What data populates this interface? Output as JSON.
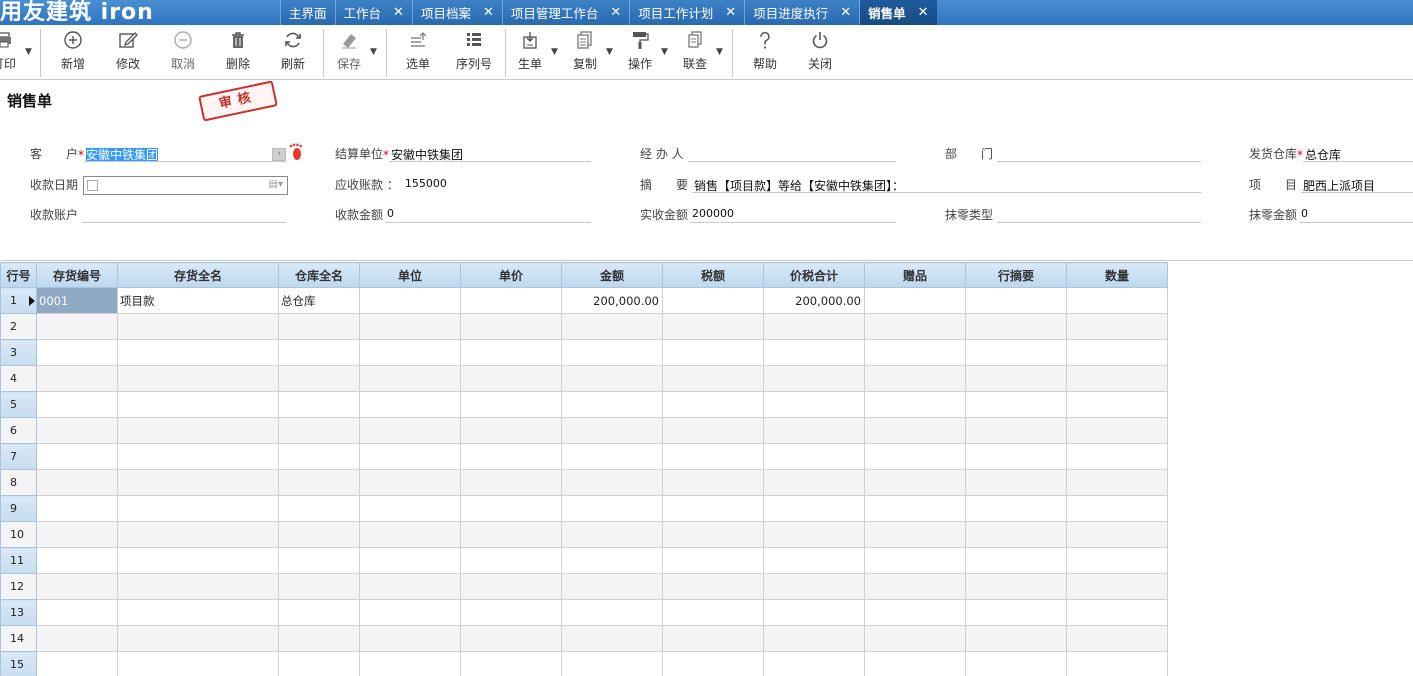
{
  "app": {
    "logo_text": "用友建筑 iron"
  },
  "tabs": [
    {
      "label": "主界面",
      "closable": false,
      "active": false
    },
    {
      "label": "工作台",
      "closable": true,
      "active": false
    },
    {
      "label": "项目档案",
      "closable": true,
      "active": false
    },
    {
      "label": "项目管理工作台",
      "closable": true,
      "active": false
    },
    {
      "label": "项目工作计划",
      "closable": true,
      "active": false
    },
    {
      "label": "项目进度执行",
      "closable": true,
      "active": false
    },
    {
      "label": "销售单",
      "closable": true,
      "active": true
    }
  ],
  "tab_close_glyph": "✕",
  "toolbar": {
    "print": "打印",
    "add": "新增",
    "edit": "修改",
    "cancel": "取消",
    "delete": "删除",
    "refresh": "刷新",
    "save": "保存",
    "select": "选单",
    "serial": "序列号",
    "generate": "生单",
    "copy": "复制",
    "operate": "操作",
    "link": "联查",
    "help": "帮助",
    "close": "关闭"
  },
  "page": {
    "title": "销售单",
    "stamp": "审核"
  },
  "form": {
    "customer": {
      "label": "客　　户",
      "value": "安徽中铁集团"
    },
    "settle_unit": {
      "label": "结算单位",
      "value": "安徽中铁集团"
    },
    "handler": {
      "label": "经 办 人",
      "value": ""
    },
    "dept": {
      "label": "部　　门",
      "value": ""
    },
    "warehouse": {
      "label": "发货仓库",
      "value": "总仓库"
    },
    "pay_date": {
      "label": "收款日期",
      "value": ""
    },
    "receivable": {
      "label": "应收账款 ：",
      "value": "155000"
    },
    "summary": {
      "label": "摘　　要",
      "value": "销售【项目款】等给【安徽中铁集团】："
    },
    "project": {
      "label": "项　　目",
      "value": "肥西上派项目"
    },
    "pay_account": {
      "label": "收款账户",
      "value": ""
    },
    "pay_amount": {
      "label": "收款金额",
      "value": "0"
    },
    "actual_amount": {
      "label": "实收金额",
      "value": "200000"
    },
    "round_type": {
      "label": "抹零类型",
      "value": ""
    },
    "round_amount": {
      "label": "抹零金额",
      "value": "0"
    }
  },
  "grid": {
    "columns": [
      "行号",
      "存货编号",
      "存货全名",
      "仓库全名",
      "单位",
      "单价",
      "金额",
      "税额",
      "价税合计",
      "赠品",
      "行摘要",
      "数量"
    ],
    "rows": [
      [
        "1",
        "0001",
        "项目款",
        "总仓库",
        "",
        "",
        "200,000.00",
        "",
        "200,000.00",
        "",
        "",
        ""
      ],
      [
        "2",
        "",
        "",
        "",
        "",
        "",
        "",
        "",
        "",
        "",
        "",
        ""
      ],
      [
        "3",
        "",
        "",
        "",
        "",
        "",
        "",
        "",
        "",
        "",
        "",
        ""
      ],
      [
        "4",
        "",
        "",
        "",
        "",
        "",
        "",
        "",
        "",
        "",
        "",
        ""
      ],
      [
        "5",
        "",
        "",
        "",
        "",
        "",
        "",
        "",
        "",
        "",
        "",
        ""
      ],
      [
        "6",
        "",
        "",
        "",
        "",
        "",
        "",
        "",
        "",
        "",
        "",
        ""
      ],
      [
        "7",
        "",
        "",
        "",
        "",
        "",
        "",
        "",
        "",
        "",
        "",
        ""
      ],
      [
        "8",
        "",
        "",
        "",
        "",
        "",
        "",
        "",
        "",
        "",
        "",
        ""
      ],
      [
        "9",
        "",
        "",
        "",
        "",
        "",
        "",
        "",
        "",
        "",
        "",
        ""
      ],
      [
        "10",
        "",
        "",
        "",
        "",
        "",
        "",
        "",
        "",
        "",
        "",
        ""
      ],
      [
        "11",
        "",
        "",
        "",
        "",
        "",
        "",
        "",
        "",
        "",
        "",
        ""
      ],
      [
        "12",
        "",
        "",
        "",
        "",
        "",
        "",
        "",
        "",
        "",
        "",
        ""
      ],
      [
        "13",
        "",
        "",
        "",
        "",
        "",
        "",
        "",
        "",
        "",
        "",
        ""
      ],
      [
        "14",
        "",
        "",
        "",
        "",
        "",
        "",
        "",
        "",
        "",
        "",
        ""
      ],
      [
        "15",
        "",
        "",
        "",
        "",
        "",
        "",
        "",
        "",
        "",
        "",
        ""
      ]
    ]
  }
}
